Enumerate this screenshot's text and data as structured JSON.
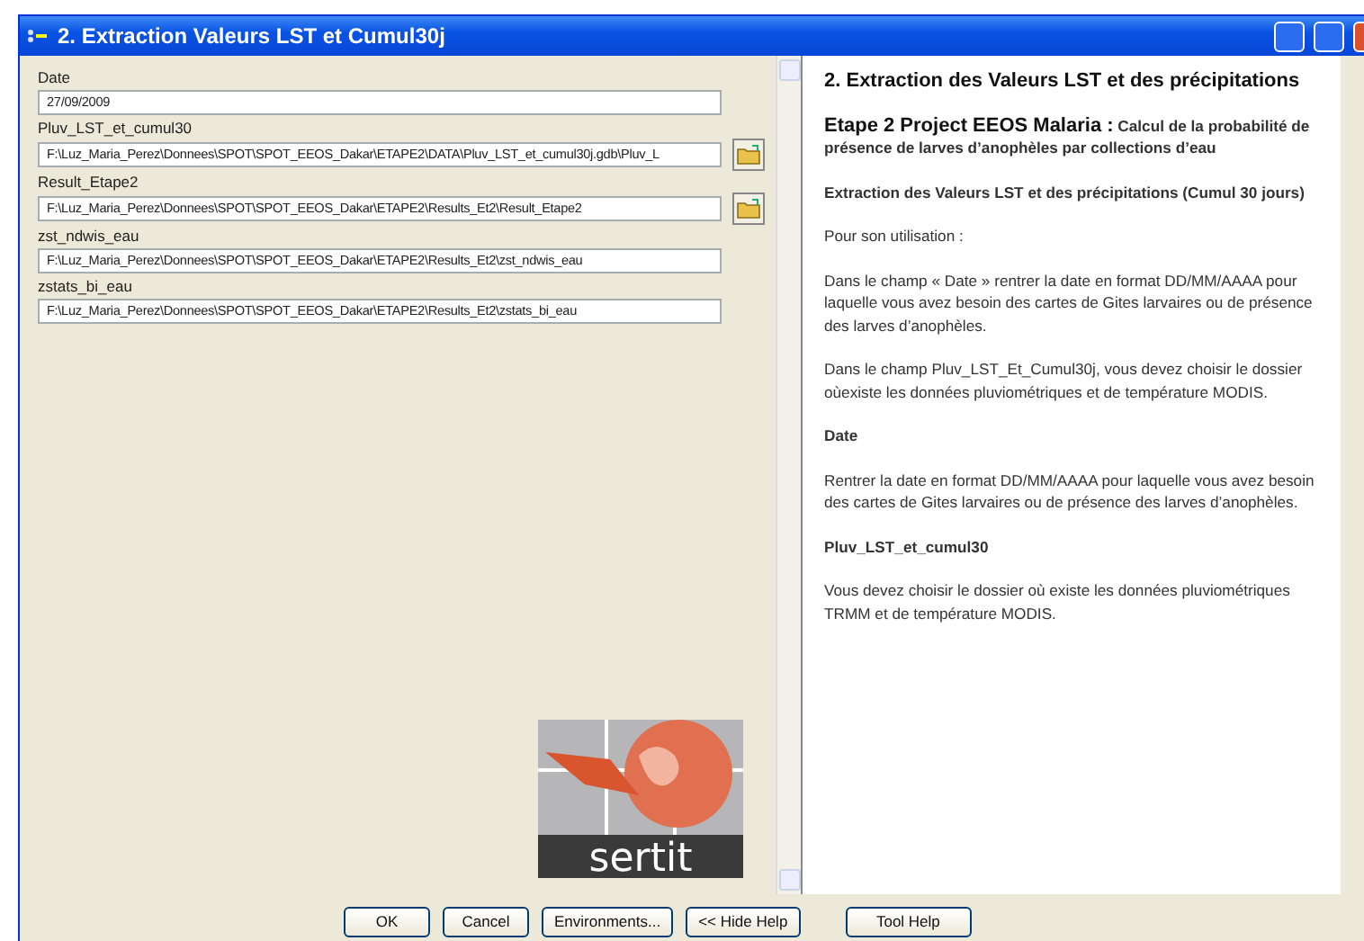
{
  "window": {
    "title": "2. Extraction Valeurs LST et Cumul30j"
  },
  "parameters": [
    {
      "label": "Date",
      "value": "27/09/2009",
      "browse": false
    },
    {
      "label": "Pluv_LST_et_cumul30",
      "value": "F:\\Luz_Maria_Perez\\Donnees\\SPOT\\SPOT_EEOS_Dakar\\ETAPE2\\DATA\\Pluv_LST_et_cumul30j.gdb\\Pluv_L",
      "browse": true
    },
    {
      "label": "Result_Etape2",
      "value": "F:\\Luz_Maria_Perez\\Donnees\\SPOT\\SPOT_EEOS_Dakar\\ETAPE2\\Results_Et2\\Result_Etape2",
      "browse": true
    },
    {
      "label": "zst_ndwis_eau",
      "value": "F:\\Luz_Maria_Perez\\Donnees\\SPOT\\SPOT_EEOS_Dakar\\ETAPE2\\Results_Et2\\zst_ndwis_eau",
      "browse": false
    },
    {
      "label": "zstats_bi_eau",
      "value": "F:\\Luz_Maria_Perez\\Donnees\\SPOT\\SPOT_EEOS_Dakar\\ETAPE2\\Results_Et2\\zstats_bi_eau",
      "browse": false
    }
  ],
  "logo": {
    "text": "sertit"
  },
  "help": [
    {
      "kind": "title",
      "text": "2. Extraction des Valeurs LST et des précipitations"
    },
    {
      "kind": "intro",
      "lead": "Etape 2 Project EEOS Malaria :",
      "text": "Calcul de la probabilité de présence de larves d’anophèles par collections d’eau"
    },
    {
      "kind": "heading",
      "text": "Extraction des Valeurs LST et des précipitations (Cumul 30 jours)"
    },
    {
      "kind": "text",
      "text": "Pour son utilisation :"
    },
    {
      "kind": "text",
      "text": "Dans le champ « Date » rentrer la date en format DD/MM/AAAA pour laquelle vous avez besoin des cartes de Gites larvaires ou de présence des larves d’anophèles."
    },
    {
      "kind": "text",
      "text": "Dans le champ Pluv_LST_Et_Cumul30j, vous devez choisir le dossier oùexiste les données pluviométriques et de température MODIS."
    },
    {
      "kind": "heading",
      "text": "Date"
    },
    {
      "kind": "text",
      "text": "Rentrer la date en format DD/MM/AAAA pour laquelle vous avez besoin des cartes de Gites larvaires ou de présence des larves d’anophèles."
    },
    {
      "kind": "heading",
      "text": "Pluv_LST_et_cumul30"
    },
    {
      "kind": "text",
      "text": "Vous devez choisir le dossier où existe les données pluviométriques TRMM et de température MODIS."
    }
  ],
  "buttons": [
    "OK",
    "Cancel",
    "Environments...",
    "<< Hide Help",
    "Tool Help"
  ]
}
